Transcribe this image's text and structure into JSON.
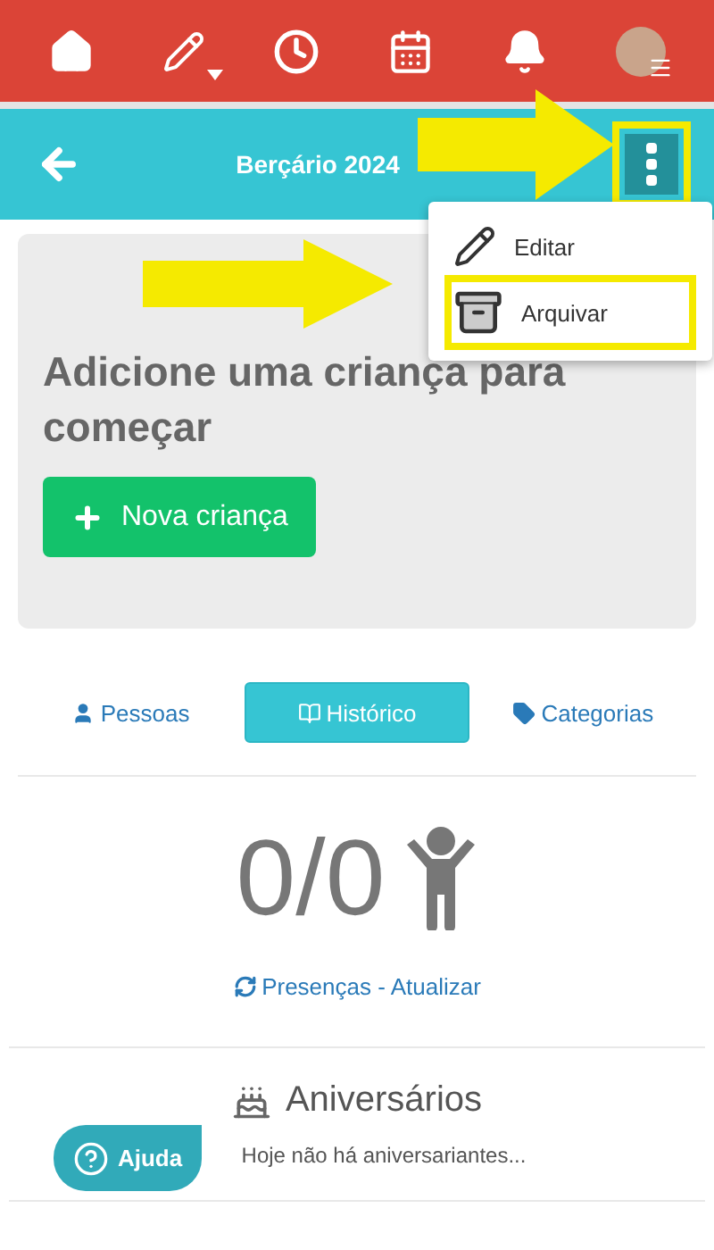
{
  "top_nav": {
    "items": [
      {
        "kind": "home"
      },
      {
        "kind": "edit"
      },
      {
        "kind": "clock"
      },
      {
        "kind": "calendar"
      },
      {
        "kind": "bell"
      },
      {
        "kind": "avatar"
      }
    ]
  },
  "header": {
    "title": "Berçário 2024"
  },
  "menu": {
    "items": [
      {
        "kind": "edit",
        "label": "Editar",
        "highlighted": false
      },
      {
        "kind": "archive",
        "label": "Arquivar",
        "highlighted": true
      }
    ]
  },
  "empty_card": {
    "heading": "Adicione uma criança para começar",
    "button": "Nova criança"
  },
  "tabs": [
    {
      "kind": "people",
      "label": "Pessoas",
      "selected": false
    },
    {
      "kind": "history",
      "label": "Histórico",
      "selected": true
    },
    {
      "kind": "tags",
      "label": "Categorias",
      "selected": false
    }
  ],
  "attendance": {
    "count": "0/0",
    "link": "Presenças - Atualizar"
  },
  "birthdays": {
    "title": "Aniversários",
    "message": "Hoje não há aniversariantes..."
  },
  "help_button": "Ajuda"
}
